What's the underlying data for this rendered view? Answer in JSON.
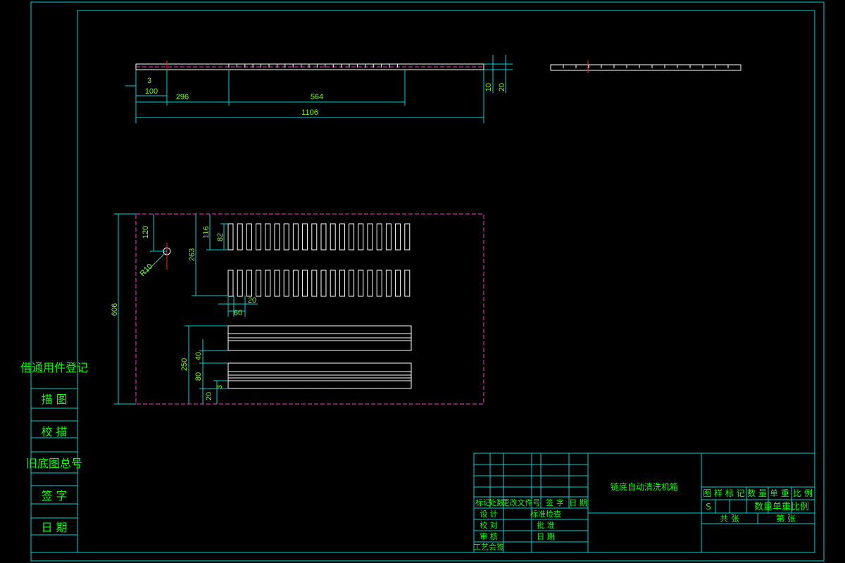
{
  "colors": {
    "background": "#000000",
    "frame": "#00d4d4",
    "geometry": "#ffffff",
    "dimension_text": "#7cfc00",
    "label_text": "#00ff00",
    "boundary": "#ff33cc",
    "center_mark": "#ff2020"
  },
  "left_register": {
    "title": "借通用件登记",
    "rows": [
      "描 图",
      "校 描",
      "旧底图总号",
      "签 字",
      "日 期"
    ]
  },
  "top_view_dims": {
    "d3": "3",
    "d100": "100",
    "d296": "296",
    "d564": "564",
    "d1106": "1106",
    "d10": "10",
    "d20": "20"
  },
  "plan_view_dims": {
    "d606": "606",
    "d120": "120",
    "r10": "R10",
    "d116": "116",
    "d82": "82",
    "d263": "263",
    "d20": "20",
    "d60": "60",
    "d250": "250",
    "d40": "40",
    "d80": "80",
    "d3": "3",
    "d20b": "20"
  },
  "title_block": {
    "drawing_name": "链底自动清洗机箱",
    "col_headers": [
      "标记",
      "处数",
      "更改文件号",
      "签 字",
      "日 期"
    ],
    "row_labels": [
      "设 计",
      "校 对",
      "审 核",
      "工艺会签"
    ],
    "mid_labels": [
      "标准检查",
      "批 准",
      "日 期"
    ],
    "right_headers": [
      "图 样 标 记",
      "数 量",
      "单 重",
      "比 例"
    ],
    "mark_s": "S",
    "right_overlay": "数量单重比例",
    "sheet_total": "共 张",
    "sheet_no": "第 张"
  }
}
